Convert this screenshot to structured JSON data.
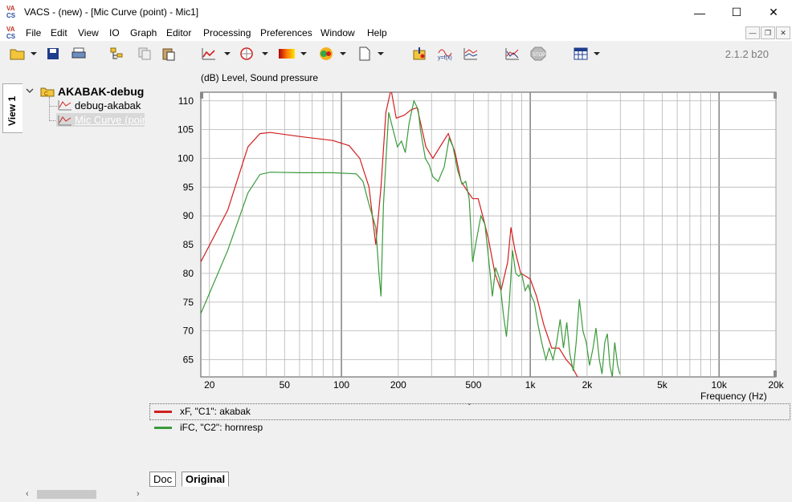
{
  "window": {
    "title": "VACS - (new) - [Mic Curve (point) - Mic1]",
    "minimize": "—",
    "maximize": "☐",
    "close": "✕"
  },
  "menu": [
    "File",
    "Edit",
    "View",
    "IO",
    "Graph",
    "Editor",
    "Processing",
    "Preferences",
    "Window",
    "Help"
  ],
  "mdi_controls": [
    "—",
    "❐",
    "✕"
  ],
  "toolbar": {
    "version": "2.1.2 b20",
    "icons": [
      "open-folder-icon",
      "save-disk-icon",
      "print-icon",
      "tree-icon",
      "copy-icon",
      "paste-icon",
      "graph-icon",
      "polar-icon",
      "color-map-icon",
      "sphere-icon",
      "new-document-icon",
      "import-icon",
      "formula-icon",
      "compare-icon",
      "process-icon",
      "stop-icon",
      "table-icon"
    ]
  },
  "left_panel": {
    "tab": "View 1",
    "tree": {
      "root": "AKABAK-debug",
      "children": [
        "debug-akabak",
        "Mic Curve (point)"
      ]
    }
  },
  "graph": {
    "y_title": "(dB)  Level, Sound pressure",
    "x_title": "Frequency  (Hz)"
  },
  "chart_data": {
    "type": "line",
    "x_scale": "log",
    "xlim": [
      18,
      20000
    ],
    "ylim": [
      62,
      111.5
    ],
    "grid": true,
    "xticks": [
      20,
      50,
      100,
      200,
      500,
      1000,
      2000,
      5000,
      10000,
      20000
    ],
    "xtick_labels": [
      "20",
      "50",
      "100",
      "200",
      "500",
      "1k",
      "2k",
      "5k",
      "10k",
      "20k"
    ],
    "yticks": [
      65,
      70,
      75,
      80,
      85,
      90,
      95,
      100,
      105,
      110
    ],
    "series": [
      {
        "name": "xF, \"C1\": akabak",
        "color": "#d21f1f",
        "points": [
          [
            18,
            82
          ],
          [
            25,
            91
          ],
          [
            32,
            102
          ],
          [
            37,
            104.3
          ],
          [
            42,
            104.5
          ],
          [
            60,
            103.8
          ],
          [
            90,
            103.1
          ],
          [
            110,
            102.2
          ],
          [
            125,
            100
          ],
          [
            140,
            95
          ],
          [
            152,
            85
          ],
          [
            162,
            95
          ],
          [
            172,
            108
          ],
          [
            183,
            112
          ],
          [
            195,
            107
          ],
          [
            215,
            107.5
          ],
          [
            235,
            108.5
          ],
          [
            252,
            108.8
          ],
          [
            280,
            102
          ],
          [
            305,
            100
          ],
          [
            340,
            102.5
          ],
          [
            368,
            104.3
          ],
          [
            400,
            101
          ],
          [
            430,
            96
          ],
          [
            460,
            94.5
          ],
          [
            495,
            93
          ],
          [
            530,
            93
          ],
          [
            565,
            89.5
          ],
          [
            600,
            86
          ],
          [
            650,
            80
          ],
          [
            700,
            77
          ],
          [
            760,
            82
          ],
          [
            790,
            88
          ],
          [
            830,
            84
          ],
          [
            890,
            80
          ],
          [
            950,
            79.5
          ],
          [
            1000,
            79
          ],
          [
            1080,
            76
          ],
          [
            1180,
            71
          ],
          [
            1300,
            67
          ],
          [
            1420,
            67
          ],
          [
            1550,
            65
          ],
          [
            1650,
            64
          ],
          [
            1780,
            62
          ]
        ]
      },
      {
        "name": "iFC, \"C2\": hornresp",
        "color": "#3a9a3a",
        "points": [
          [
            18,
            73
          ],
          [
            25,
            84
          ],
          [
            32,
            94
          ],
          [
            37,
            97.2
          ],
          [
            42,
            97.6
          ],
          [
            60,
            97.5
          ],
          [
            90,
            97.5
          ],
          [
            120,
            97.3
          ],
          [
            130,
            96
          ],
          [
            140,
            92
          ],
          [
            152,
            88
          ],
          [
            158,
            80
          ],
          [
            162,
            76
          ],
          [
            167,
            92
          ],
          [
            178,
            108
          ],
          [
            186,
            105.5
          ],
          [
            198,
            102
          ],
          [
            208,
            103
          ],
          [
            218,
            101
          ],
          [
            228,
            106
          ],
          [
            242,
            110
          ],
          [
            255,
            108.5
          ],
          [
            262,
            105
          ],
          [
            278,
            100
          ],
          [
            292,
            98.8
          ],
          [
            305,
            96.8
          ],
          [
            325,
            96
          ],
          [
            350,
            98.5
          ],
          [
            372,
            103.5
          ],
          [
            390,
            102
          ],
          [
            412,
            98
          ],
          [
            435,
            95.5
          ],
          [
            455,
            96
          ],
          [
            475,
            93
          ],
          [
            495,
            82
          ],
          [
            520,
            86
          ],
          [
            548,
            90
          ],
          [
            575,
            88.5
          ],
          [
            600,
            83
          ],
          [
            630,
            76
          ],
          [
            655,
            81
          ],
          [
            688,
            79
          ],
          [
            720,
            73
          ],
          [
            748,
            69
          ],
          [
            775,
            75
          ],
          [
            805,
            84
          ],
          [
            838,
            80
          ],
          [
            868,
            79.5
          ],
          [
            900,
            80
          ],
          [
            940,
            77
          ],
          [
            975,
            78
          ],
          [
            1015,
            76
          ],
          [
            1050,
            75
          ],
          [
            1100,
            71
          ],
          [
            1150,
            68
          ],
          [
            1210,
            65
          ],
          [
            1260,
            67
          ],
          [
            1320,
            65
          ],
          [
            1380,
            68
          ],
          [
            1440,
            72
          ],
          [
            1500,
            67
          ],
          [
            1560,
            71.5
          ],
          [
            1620,
            66
          ],
          [
            1690,
            63
          ],
          [
            1750,
            68
          ],
          [
            1820,
            75.5
          ],
          [
            1900,
            70
          ],
          [
            1980,
            68
          ],
          [
            2060,
            64
          ],
          [
            2150,
            67
          ],
          [
            2230,
            70.5
          ],
          [
            2320,
            65
          ],
          [
            2400,
            62.5
          ],
          [
            2480,
            68
          ],
          [
            2560,
            69.5
          ],
          [
            2640,
            64
          ],
          [
            2720,
            62
          ],
          [
            2800,
            68
          ],
          [
            2900,
            64
          ],
          [
            2980,
            62.5
          ]
        ]
      }
    ]
  },
  "bottom_tabs": [
    "Doc",
    "Original"
  ]
}
